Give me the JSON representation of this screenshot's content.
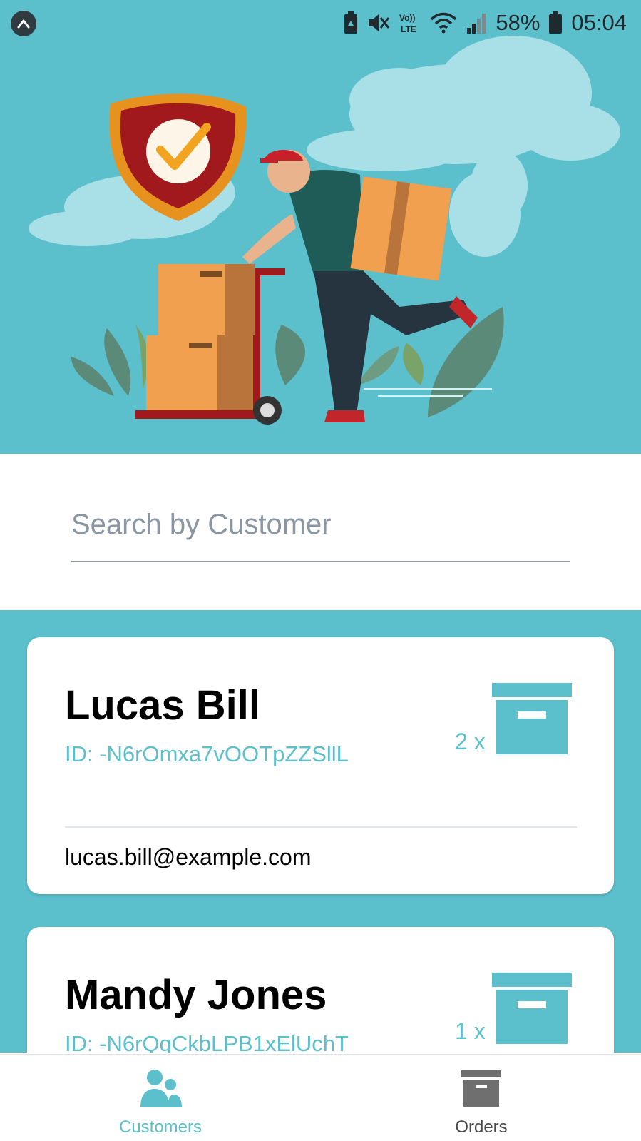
{
  "status_bar": {
    "battery_percent": "58%",
    "time": "05:04",
    "icons": [
      "app-badge-icon",
      "battery-saver-icon",
      "mute-icon",
      "volte-icon",
      "wifi-icon",
      "signal-icon",
      "battery-icon"
    ]
  },
  "hero": {
    "illustration": "delivery-man-with-boxes-and-shield-illustration"
  },
  "search": {
    "placeholder": "Search by Customer",
    "value": ""
  },
  "customers": [
    {
      "name": "Lucas Bill",
      "id": "ID: -N6rOmxa7vOOTpZZSllL",
      "order_count": "2 x",
      "email": "lucas.bill@example.com"
    },
    {
      "name": "Mandy Jones",
      "id": "ID: -N6rQgCkbLPB1xElUchT",
      "order_count": "1 x",
      "email": ""
    }
  ],
  "bottom_nav": {
    "customers_label": "Customers",
    "orders_label": "Orders",
    "active": "Customers"
  },
  "colors": {
    "accent": "#5bbfcc",
    "text_primary": "#000000",
    "nav_inactive": "#4a4a4a"
  }
}
